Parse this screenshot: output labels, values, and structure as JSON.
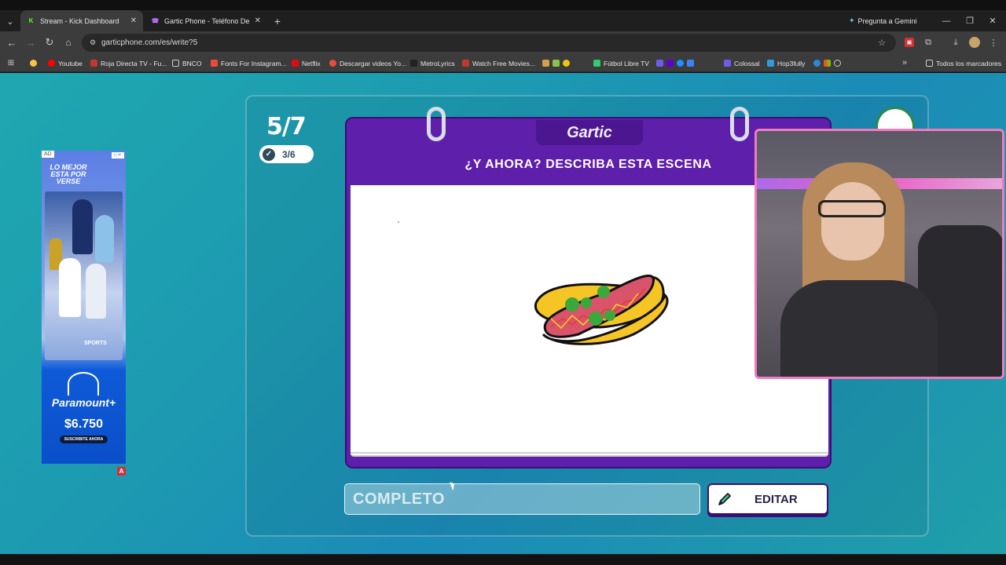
{
  "browser": {
    "tabs": [
      {
        "title": "Stream - Kick Dashboard",
        "favicon": "K",
        "favicon_color": "#53fc18",
        "active": true
      },
      {
        "title": "Gartic Phone - Teléfono Descon",
        "favicon": "☎",
        "favicon_color": "#b66cf0",
        "active": false
      }
    ],
    "gemini_label": "Pregunta a Gemini",
    "url": "garticphone.com/es/write?5",
    "bookmarks": [
      {
        "label": "",
        "color": "#f6c544"
      },
      {
        "label": "Youtube",
        "color": "#ff0000"
      },
      {
        "label": "Roja Directa TV - Fu...",
        "color": "#c0392b"
      },
      {
        "label": "BNCO",
        "color": "#888888"
      },
      {
        "label": "Fonts For Instagram...",
        "color": "#e84c3d"
      },
      {
        "label": "Netflix",
        "color": "#e50914"
      },
      {
        "label": "Descargar videos Yo...",
        "color": "#e74c3c"
      },
      {
        "label": "MetroLyrics",
        "color": "#222222"
      },
      {
        "label": "Watch Free Movies...",
        "color": "#c0392b"
      },
      {
        "label": "Fútbol Libre TV",
        "color": "#2ecc71"
      },
      {
        "label": "Colossal",
        "color": "#6c5ce7"
      },
      {
        "label": "Hop3fully",
        "color": "#3498db"
      }
    ],
    "all_bookmarks_label": "Todos los marcadores"
  },
  "game": {
    "round": "5/7",
    "done_count": "3/6",
    "logo": "Gartic",
    "prompt": "¿Y AHORA? DESCRIBA ESTA ESCENA",
    "answer_value": "COMPLETO",
    "edit_label": "EDITAR"
  },
  "ad": {
    "badge": "AD",
    "headline": "LO MEJOR ESTA POR VERSE",
    "sponsor": "SPORTS",
    "brand": "Paramount+",
    "price": "$6.750",
    "cta": "SUSCRIBITE AHORA"
  },
  "colors": {
    "card_purple": "#5e1faa",
    "background_teal": "#1fa7b0",
    "webcam_border": "#ef7cc1"
  }
}
